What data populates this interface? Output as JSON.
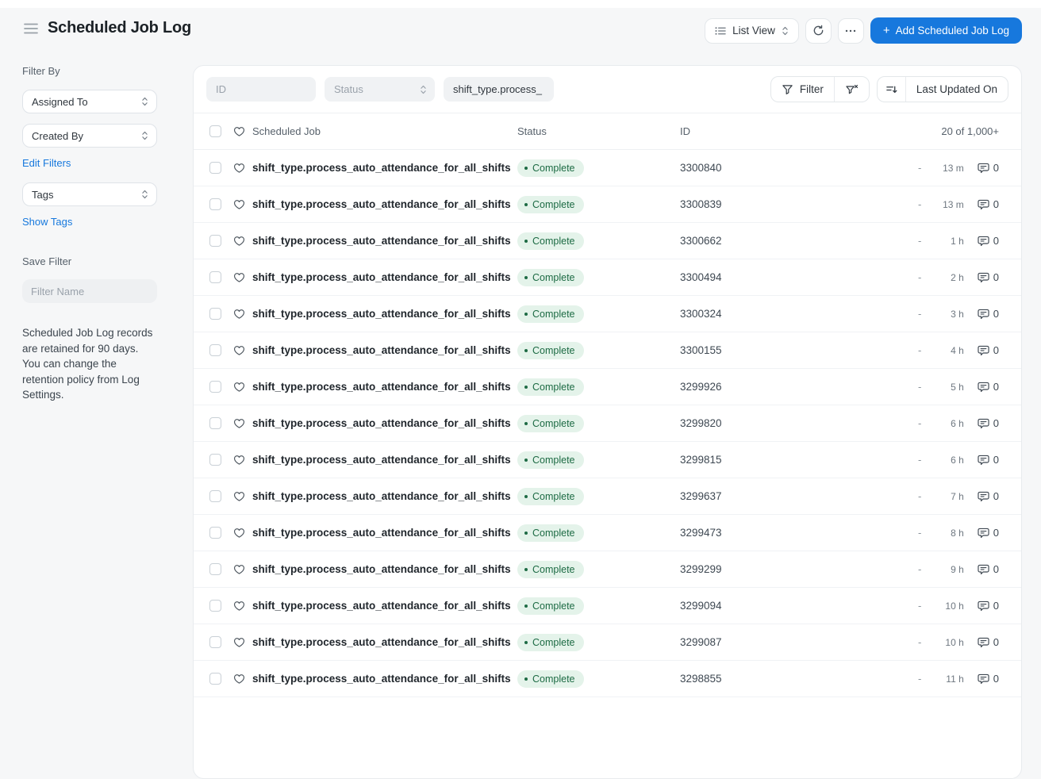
{
  "colors": {
    "primary_blue": "#1778dd",
    "link_blue": "#1678dd",
    "badge_bg": "#e4f3ea",
    "badge_text": "#1d6b44",
    "page_bg": "#f6f7f8"
  },
  "header": {
    "title": "Scheduled Job Log",
    "view_button": "List View",
    "add_plus": "+",
    "add_button": "Add Scheduled Job Log"
  },
  "sidebar": {
    "filter_by_label": "Filter By",
    "assigned_to": "Assigned To",
    "created_by": "Created By",
    "edit_filters_link": "Edit Filters",
    "tags": "Tags",
    "show_tags_link": "Show Tags",
    "save_filter_label": "Save Filter",
    "filter_name_placeholder": "Filter Name",
    "note": "Scheduled Job Log records are retained for 90 days. You can change the retention policy from Log Settings."
  },
  "toolbar": {
    "id_placeholder": "ID",
    "status_placeholder": "Status",
    "job_filter_value": "shift_type.process_",
    "filter_button": "Filter",
    "sort_button": "Last Updated On"
  },
  "table": {
    "columns": {
      "job": "Scheduled Job",
      "status": "Status",
      "id": "ID"
    },
    "count": "20 of 1,000+",
    "rows": [
      {
        "job": "shift_type.process_auto_attendance_for_all_shifts",
        "status": "Complete",
        "id": "3300840",
        "assigned": "-",
        "modified": "13 m",
        "comments": "0"
      },
      {
        "job": "shift_type.process_auto_attendance_for_all_shifts",
        "status": "Complete",
        "id": "3300839",
        "assigned": "-",
        "modified": "13 m",
        "comments": "0"
      },
      {
        "job": "shift_type.process_auto_attendance_for_all_shifts",
        "status": "Complete",
        "id": "3300662",
        "assigned": "-",
        "modified": "1 h",
        "comments": "0"
      },
      {
        "job": "shift_type.process_auto_attendance_for_all_shifts",
        "status": "Complete",
        "id": "3300494",
        "assigned": "-",
        "modified": "2 h",
        "comments": "0"
      },
      {
        "job": "shift_type.process_auto_attendance_for_all_shifts",
        "status": "Complete",
        "id": "3300324",
        "assigned": "-",
        "modified": "3 h",
        "comments": "0"
      },
      {
        "job": "shift_type.process_auto_attendance_for_all_shifts",
        "status": "Complete",
        "id": "3300155",
        "assigned": "-",
        "modified": "4 h",
        "comments": "0"
      },
      {
        "job": "shift_type.process_auto_attendance_for_all_shifts",
        "status": "Complete",
        "id": "3299926",
        "assigned": "-",
        "modified": "5 h",
        "comments": "0"
      },
      {
        "job": "shift_type.process_auto_attendance_for_all_shifts",
        "status": "Complete",
        "id": "3299820",
        "assigned": "-",
        "modified": "6 h",
        "comments": "0"
      },
      {
        "job": "shift_type.process_auto_attendance_for_all_shifts",
        "status": "Complete",
        "id": "3299815",
        "assigned": "-",
        "modified": "6 h",
        "comments": "0"
      },
      {
        "job": "shift_type.process_auto_attendance_for_all_shifts",
        "status": "Complete",
        "id": "3299637",
        "assigned": "-",
        "modified": "7 h",
        "comments": "0"
      },
      {
        "job": "shift_type.process_auto_attendance_for_all_shifts",
        "status": "Complete",
        "id": "3299473",
        "assigned": "-",
        "modified": "8 h",
        "comments": "0"
      },
      {
        "job": "shift_type.process_auto_attendance_for_all_shifts",
        "status": "Complete",
        "id": "3299299",
        "assigned": "-",
        "modified": "9 h",
        "comments": "0"
      },
      {
        "job": "shift_type.process_auto_attendance_for_all_shifts",
        "status": "Complete",
        "id": "3299094",
        "assigned": "-",
        "modified": "10 h",
        "comments": "0"
      },
      {
        "job": "shift_type.process_auto_attendance_for_all_shifts",
        "status": "Complete",
        "id": "3299087",
        "assigned": "-",
        "modified": "10 h",
        "comments": "0"
      },
      {
        "job": "shift_type.process_auto_attendance_for_all_shifts",
        "status": "Complete",
        "id": "3298855",
        "assigned": "-",
        "modified": "11 h",
        "comments": "0"
      }
    ]
  }
}
